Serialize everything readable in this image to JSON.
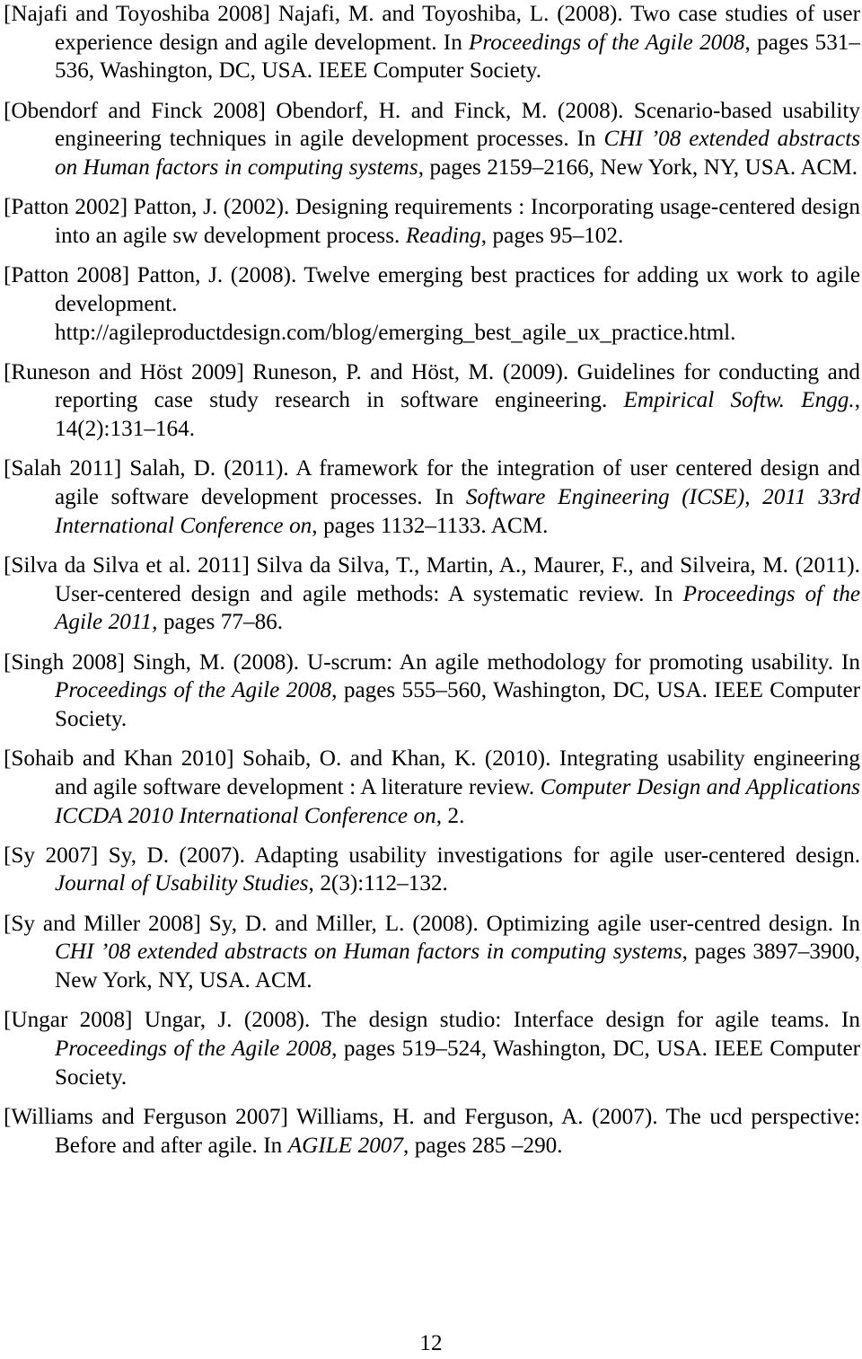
{
  "page": {
    "number": "12",
    "section": "references"
  },
  "references": [
    {
      "key": "[Najafi and Toyoshiba 2008]",
      "parts": [
        {
          "text": " Najafi, M. and Toyoshiba, L. (2008). Two case studies of user experience design and agile development. In ",
          "style": "roman"
        },
        {
          "text": "Proceedings of the Agile 2008",
          "style": "italic"
        },
        {
          "text": ", pages 531–536, Washington, DC, USA. IEEE Computer Society.",
          "style": "roman"
        }
      ]
    },
    {
      "key": "[Obendorf and Finck 2008]",
      "parts": [
        {
          "text": " Obendorf, H. and Finck, M. (2008). Scenario-based usability engineering techniques in agile development processes. In ",
          "style": "roman"
        },
        {
          "text": "CHI ’08 extended abstracts on Human factors in computing systems",
          "style": "italic"
        },
        {
          "text": ", pages 2159–2166, New York, NY, USA. ACM.",
          "style": "roman"
        }
      ]
    },
    {
      "key": "[Patton 2002]",
      "parts": [
        {
          "text": " Patton, J. (2002). Designing requirements : Incorporating usage-centered design into an agile sw development process. ",
          "style": "roman"
        },
        {
          "text": "Reading",
          "style": "italic"
        },
        {
          "text": ", pages 95–102.",
          "style": "roman"
        }
      ]
    },
    {
      "key": "[Patton 2008]",
      "parts": [
        {
          "text": " Patton, J. (2008). Twelve emerging best practices for adding ux work to agile development. http://agileproductdesign.com/blog/emerging_best_agile_ux_practice.html.",
          "style": "roman"
        }
      ]
    },
    {
      "key": "[Runeson and Höst 2009]",
      "parts": [
        {
          "text": " Runeson, P. and Höst, M. (2009). Guidelines for conducting and reporting case study research in software engineering. ",
          "style": "roman"
        },
        {
          "text": "Empirical Softw. Engg.",
          "style": "italic"
        },
        {
          "text": ", 14(2):131–164.",
          "style": "roman"
        }
      ]
    },
    {
      "key": "[Salah 2011]",
      "parts": [
        {
          "text": " Salah, D. (2011). A framework for the integration of user centered design and agile software development processes. In ",
          "style": "roman"
        },
        {
          "text": "Software Engineering (ICSE), 2011 33rd International Conference on",
          "style": "italic"
        },
        {
          "text": ", pages 1132–1133. ACM.",
          "style": "roman"
        }
      ]
    },
    {
      "key": "[Silva da Silva et al. 2011]",
      "parts": [
        {
          "text": " Silva da Silva, T., Martin, A., Maurer, F., and Silveira, M. (2011). User-centered design and agile methods: A systematic review. In ",
          "style": "roman"
        },
        {
          "text": "Proceedings of the Agile 2011",
          "style": "italic"
        },
        {
          "text": ", pages 77–86.",
          "style": "roman"
        }
      ]
    },
    {
      "key": "[Singh 2008]",
      "parts": [
        {
          "text": " Singh, M. (2008). U-scrum: An agile methodology for promoting usability. In ",
          "style": "roman"
        },
        {
          "text": "Proceedings of the Agile 2008",
          "style": "italic"
        },
        {
          "text": ", pages 555–560, Washington, DC, USA. IEEE Computer Society.",
          "style": "roman"
        }
      ]
    },
    {
      "key": "[Sohaib and Khan 2010]",
      "parts": [
        {
          "text": " Sohaib, O. and Khan, K. (2010). Integrating usability engineering and agile software development : A literature review. ",
          "style": "roman"
        },
        {
          "text": "Computer Design and Applications ICCDA 2010 International Conference on",
          "style": "italic"
        },
        {
          "text": ", 2.",
          "style": "roman"
        }
      ]
    },
    {
      "key": "[Sy 2007]",
      "parts": [
        {
          "text": " Sy, D. (2007). Adapting usability investigations for agile user-centered design. ",
          "style": "roman"
        },
        {
          "text": "Journal of Usability Studies",
          "style": "italic"
        },
        {
          "text": ", 2(3):112–132.",
          "style": "roman"
        }
      ]
    },
    {
      "key": "[Sy and Miller 2008]",
      "parts": [
        {
          "text": " Sy, D. and Miller, L. (2008). Optimizing agile user-centred design. In ",
          "style": "roman"
        },
        {
          "text": "CHI ’08 extended abstracts on Human factors in computing systems",
          "style": "italic"
        },
        {
          "text": ", pages 3897–3900, New York, NY, USA. ACM.",
          "style": "roman"
        }
      ]
    },
    {
      "key": "[Ungar 2008]",
      "parts": [
        {
          "text": " Ungar, J. (2008). The design studio: Interface design for agile teams. In ",
          "style": "roman"
        },
        {
          "text": "Proceedings of the Agile 2008",
          "style": "italic"
        },
        {
          "text": ", pages 519–524, Washington, DC, USA. IEEE Computer Society.",
          "style": "roman"
        }
      ]
    },
    {
      "key": "[Williams and Ferguson 2007]",
      "parts": [
        {
          "text": " Williams, H. and Ferguson, A. (2007). The ucd perspective: Before and after agile. In ",
          "style": "roman"
        },
        {
          "text": "AGILE 2007",
          "style": "italic"
        },
        {
          "text": ", pages 285 –290.",
          "style": "roman"
        }
      ]
    }
  ]
}
